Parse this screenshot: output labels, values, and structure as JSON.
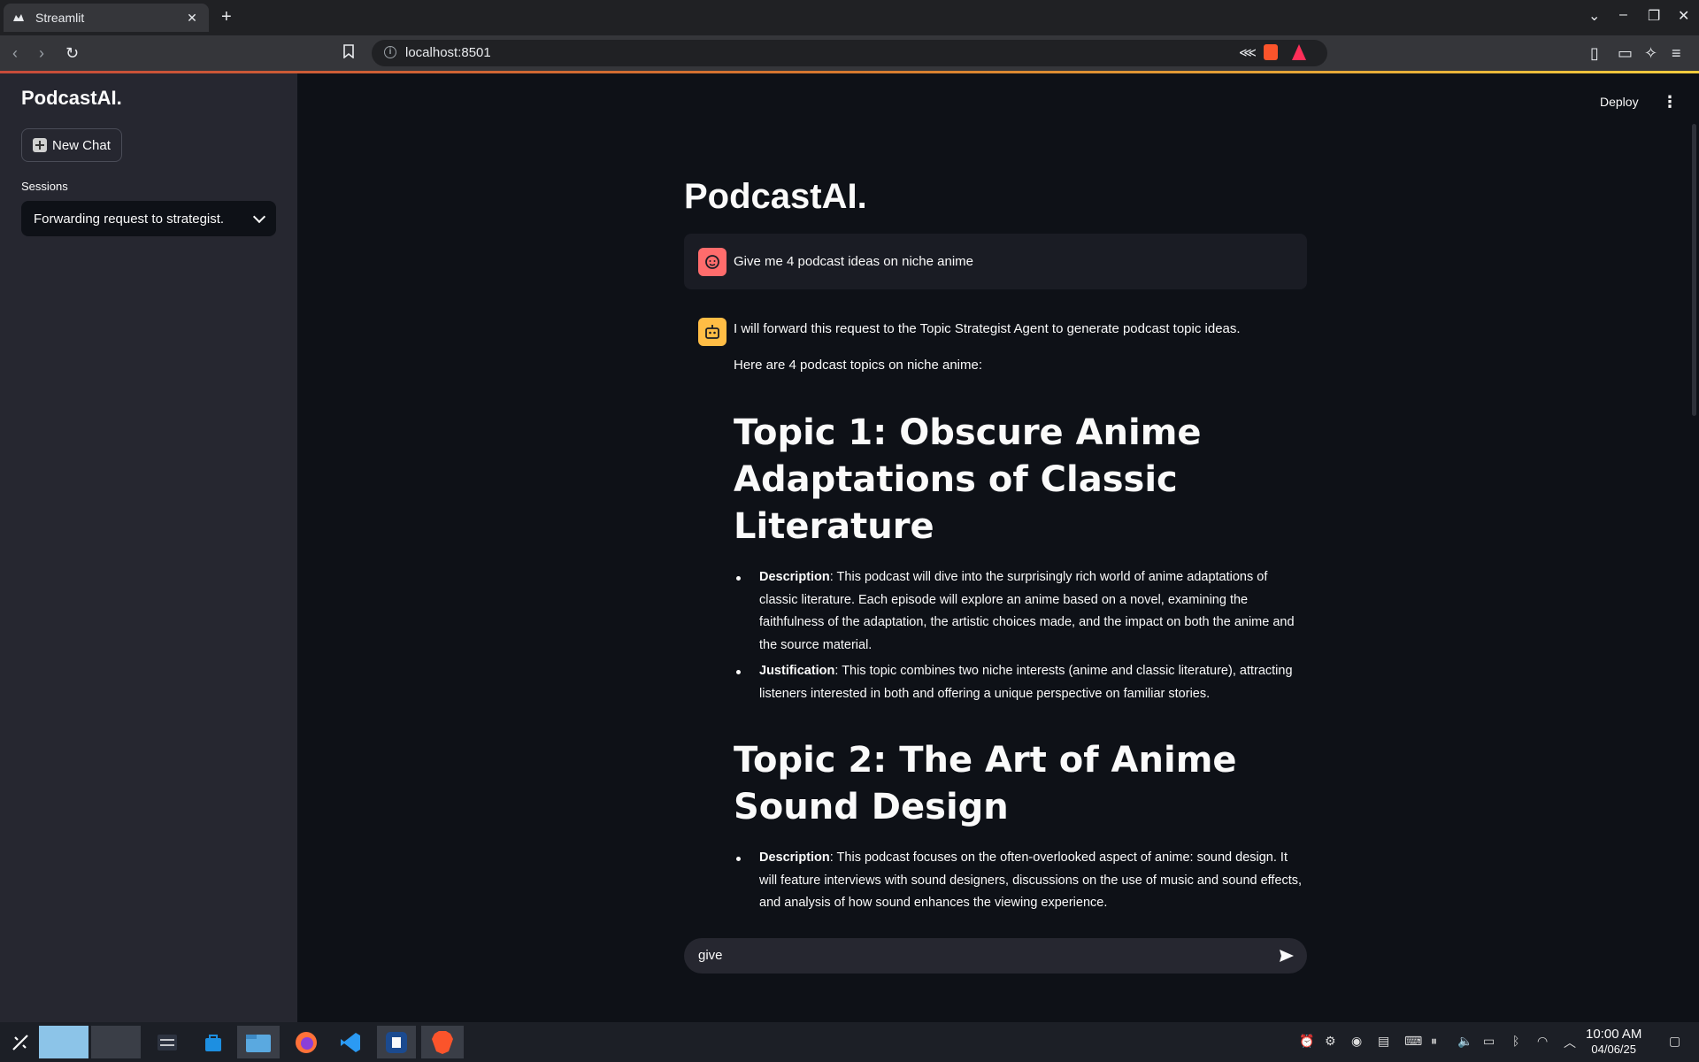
{
  "browser": {
    "tab_title": "Streamlit",
    "new_tab_symbol": "+",
    "url": "localhost:8501"
  },
  "sidebar": {
    "title": "PodcastAI.",
    "new_chat_label": "New Chat",
    "sessions_label": "Sessions",
    "session_selected": "Forwarding request to strategist."
  },
  "header": {
    "deploy_label": "Deploy",
    "menu_symbol": "⋮"
  },
  "main": {
    "title": "PodcastAI.",
    "user_message": "Give me 4 podcast ideas on niche anime",
    "assistant": {
      "line1": "I will forward this request to the Topic Strategist Agent to generate podcast topic ideas.",
      "line2": "Here are 4 podcast topics on niche anime:",
      "topics": [
        {
          "heading": "Topic 1: Obscure Anime Adaptations of Classic Literature",
          "description_label": "Description",
          "description": ": This podcast will dive into the surprisingly rich world of anime adaptations of classic literature. Each episode will explore an anime based on a novel, examining the faithfulness of the adaptation, the artistic choices made, and the impact on both the anime and the source material.",
          "justification_label": "Justification",
          "justification": ": This topic combines two niche interests (anime and classic literature), attracting listeners interested in both and offering a unique perspective on familiar stories."
        },
        {
          "heading": "Topic 2: The Art of Anime Sound Design",
          "description_label": "Description",
          "description": ": This podcast focuses on the often-overlooked aspect of anime: sound design. It will feature interviews with sound designers, discussions on the use of music and sound effects, and analysis of how sound enhances the viewing experience."
        }
      ]
    },
    "chat_input_value": "give"
  },
  "taskbar": {
    "time": "10:00 AM",
    "date": "04/06/25"
  },
  "colors": {
    "background": "#0e1117",
    "sidebar": "#262730",
    "user_avatar": "#ff6c6c",
    "bot_avatar": "#ffbd45"
  }
}
